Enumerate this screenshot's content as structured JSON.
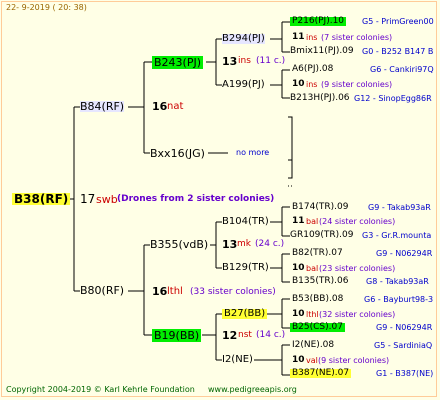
{
  "header": {
    "date": "22-  9-2019 (  20:  38)"
  },
  "root": {
    "id": "B38(RF)",
    "gen_num": "17",
    "label": "swb",
    "drones": "(Drones from 2 sister colonies)"
  },
  "level1": {
    "upper": {
      "id": "B84(RF)",
      "num": "16",
      "label": "nat"
    },
    "lower": {
      "id": "B80(RF)",
      "num": "16",
      "label": "lthl",
      "note": "(33 sister colonies)"
    }
  },
  "level2": {
    "a": {
      "id": "B243(PJ)",
      "num": "13",
      "label": "ins",
      "note": "(11 c.)"
    },
    "b": {
      "id": "Bxx16(JG)",
      "note": "no more"
    },
    "c": {
      "id": "B355(vdB)",
      "num": "13",
      "label": "mk",
      "note": "(24 c.)"
    },
    "d": {
      "id": "B19(BB)",
      "num": "12",
      "label": "nst",
      "note": "(14 c.)"
    }
  },
  "level3": {
    "a": "B294(PJ)",
    "b": "A199(PJ)",
    "c": "B104(TR)",
    "d": "B129(TR)",
    "e": "B27(BB)",
    "f": "I2(NE)"
  },
  "level4": [
    {
      "id": "P216(PJ).10",
      "gen": "G5 - PrimGreen00"
    },
    {
      "num": "11",
      "label": "ins",
      "note": "(7 sister colonies)"
    },
    {
      "id": "Bmix11(PJ).09",
      "gen": "G0 - B252 B147 B"
    },
    {
      "id": "A6(PJ).08",
      "gen": "G6 - Cankiri97Q"
    },
    {
      "num": "10",
      "label": "ins",
      "note": "(9 sister colonies)"
    },
    {
      "id": "B213H(PJ).06",
      "gen": "G12 - SinopEgg86R"
    },
    {
      "id": "B174(TR).09",
      "gen": "G9 - Takab93aR"
    },
    {
      "num": "11",
      "label": "bal",
      "note": "(24 sister colonies)"
    },
    {
      "id": "GR109(TR).09",
      "gen": "G3 - Gr.R.mounta"
    },
    {
      "id": "B82(TR).07",
      "gen": "G9 - N06294R"
    },
    {
      "num": "10",
      "label": "bal",
      "note": "(23 sister colonies)"
    },
    {
      "id": "B135(TR).06",
      "gen": "G8 - Takab93aR"
    },
    {
      "id": "B53(BB).08",
      "gen": "G6 - Bayburt98-3"
    },
    {
      "num": "10",
      "label": "lthl",
      "note": "(32 sister colonies)"
    },
    {
      "id": "B25(CS).07",
      "gen": "G9 - N06294R"
    },
    {
      "id": "I2(NE).08",
      "gen": "G5 - SardiniaQ"
    },
    {
      "num": "10",
      "label": "val",
      "note": "(9 sister colonies)"
    },
    {
      "id": "B387(NE).07",
      "gen": "G1 - B387(NE)"
    }
  ],
  "footer": {
    "copyright": "Copyright 2004-2019 © Karl Kehrle Foundation",
    "site": "www.pedigreeapis.org"
  }
}
